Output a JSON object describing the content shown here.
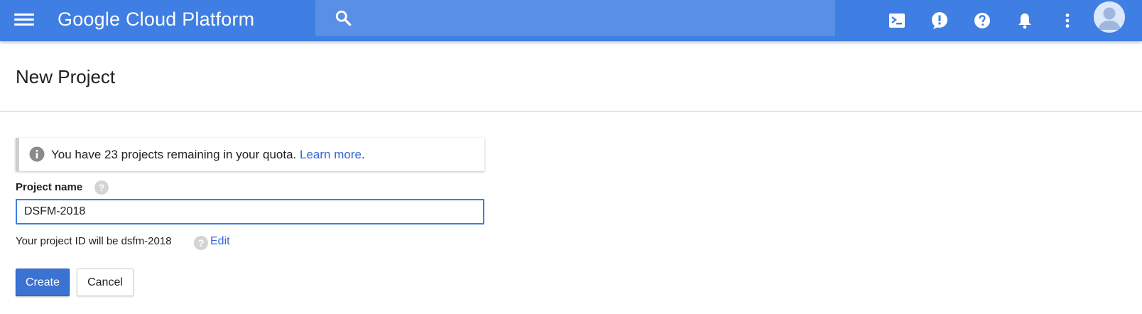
{
  "colors": {
    "topbar": "#3f7ee2",
    "search_bg": "#5a8fe6",
    "link": "#3367d6",
    "primary_button": "#3b73d3",
    "input_focus_border": "#3f7ee2"
  },
  "topbar": {
    "brand": "Google Cloud Platform",
    "menu_icon": "hamburger-menu-icon",
    "search": {
      "icon": "search-icon",
      "placeholder": "",
      "value": ""
    },
    "actions": [
      {
        "name": "cloud-shell-icon"
      },
      {
        "name": "feedback-icon"
      },
      {
        "name": "help-icon"
      },
      {
        "name": "notifications-icon"
      },
      {
        "name": "more-options-icon"
      }
    ],
    "avatar_icon": "account-avatar-icon"
  },
  "page": {
    "title": "New Project"
  },
  "quota": {
    "icon": "info-icon",
    "text": "You have 23 projects remaining in your quota.",
    "link_label": "Learn more",
    "suffix": "."
  },
  "form": {
    "project_name_label": "Project name",
    "project_name_value": "DSFM-2018",
    "project_id_text": "Your project ID will be dsfm-2018",
    "edit_label": "Edit",
    "help_glyph": "?"
  },
  "buttons": {
    "create": "Create",
    "cancel": "Cancel"
  }
}
